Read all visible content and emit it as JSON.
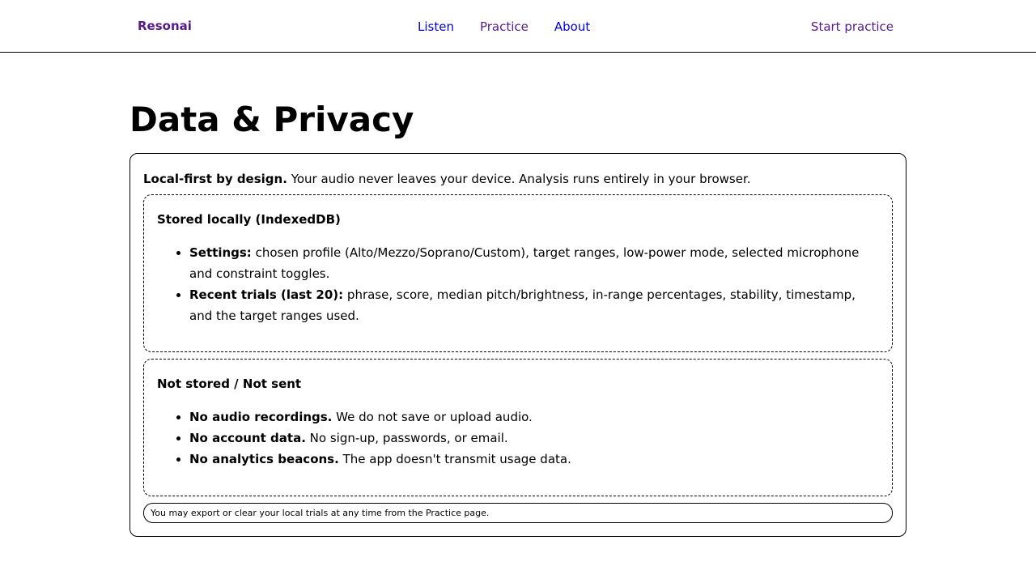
{
  "nav": {
    "brand": "Resonai",
    "links": [
      "Listen",
      "Practice",
      "About"
    ],
    "cta": "Start practice"
  },
  "page": {
    "title": "Data & Privacy"
  },
  "intro": {
    "lead": "Local-first by design.",
    "text": " Your audio never leaves your device. Analysis runs entirely in your browser."
  },
  "stored_locally": {
    "title": "Stored locally (IndexedDB)",
    "items": [
      {
        "label": "Settings:",
        "text": " chosen profile (Alto/Mezzo/Soprano/Custom), target ranges, low-power mode, selected microphone and constraint toggles."
      },
      {
        "label": "Recent trials (last 20):",
        "text": " phrase, score, median pitch/brightness, in-range percentages, stability, timestamp, and the target ranges used."
      }
    ]
  },
  "not_stored": {
    "title": "Not stored / Not sent",
    "items": [
      {
        "label": "No audio recordings.",
        "text": " We do not save or upload audio."
      },
      {
        "label": "No account data.",
        "text": " No sign-up, passwords, or email."
      },
      {
        "label": "No analytics beacons.",
        "text": " The app doesn't transmit usage data."
      }
    ]
  },
  "footer_note": "You may export or clear your local trials at any time from the Practice page."
}
